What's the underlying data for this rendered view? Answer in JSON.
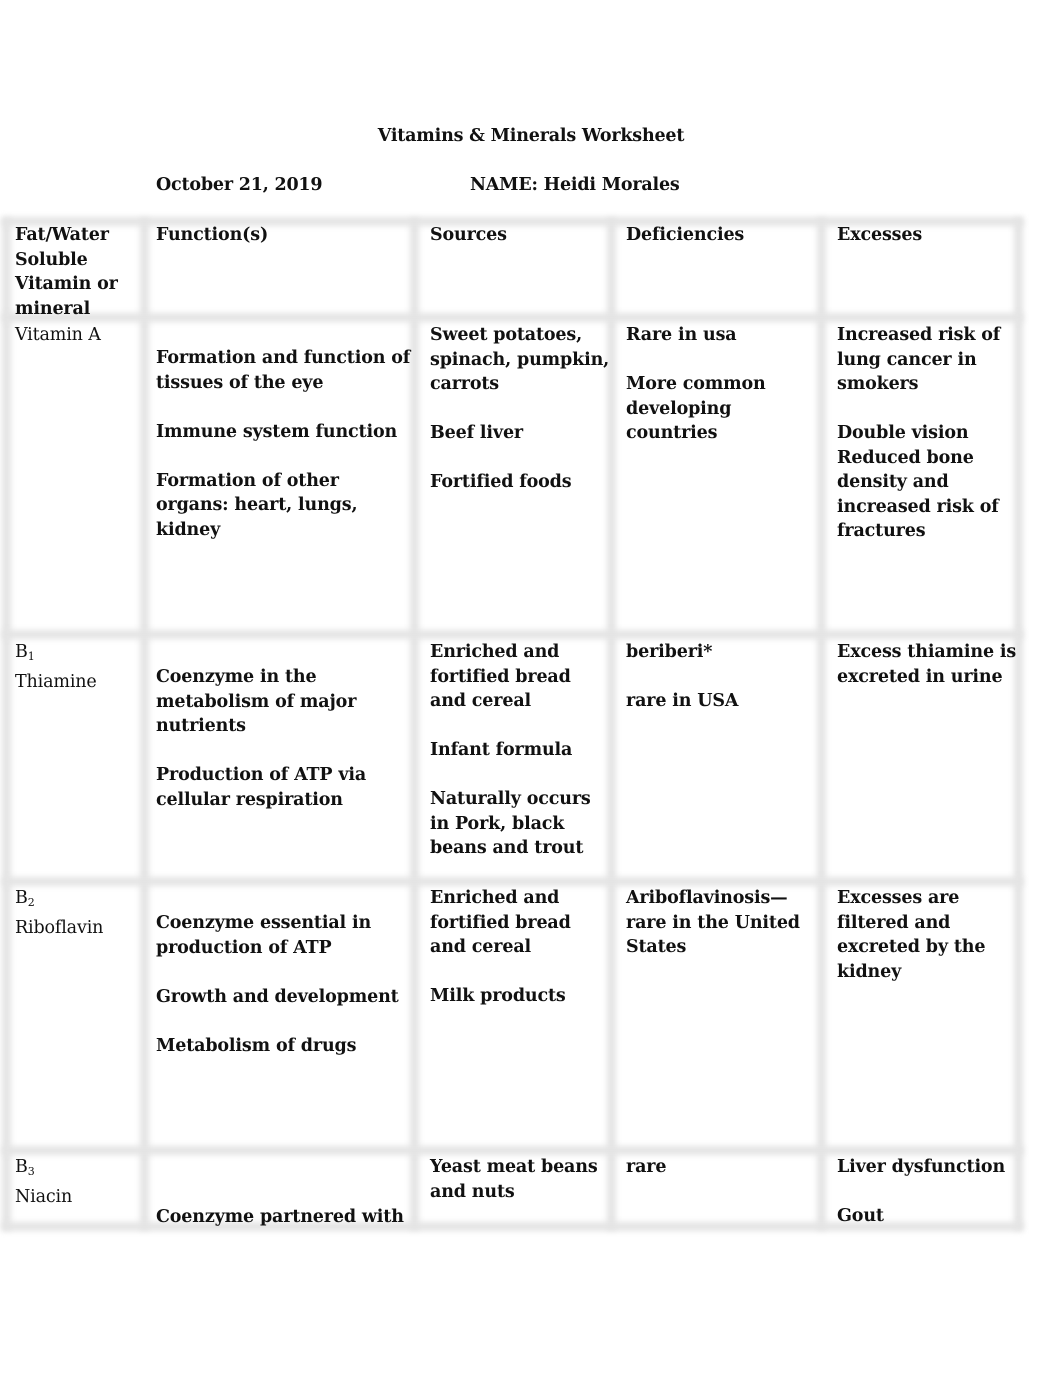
{
  "document": {
    "title": "Vitamins & Minerals Worksheet",
    "date": "October 21, 2019",
    "name_line": "NAME: Heidi Morales"
  },
  "table": {
    "headers": [
      "Fat/Water\nSoluble\nVitamin or\nmineral",
      "Function(s)",
      "Sources",
      "Deficiencies",
      "Excesses"
    ],
    "rows": [
      {
        "vitamin_prefix": "",
        "vitamin_subscript": "",
        "vitamin_name": "Vitamin A",
        "functions": "Formation and function of\ntissues of the eye\n\nImmune system function\n\nFormation of other\norgans: heart, lungs,\nkidney",
        "sources": "Sweet potatoes,\nspinach, pumpkin,\ncarrots\n\nBeef liver\n\nFortified foods",
        "deficiencies": "Rare in usa\n\nMore common\ndeveloping\ncountries",
        "excesses": " Increased risk of\nlung cancer in\nsmokers\n\nDouble vision\nReduced bone\ndensity and\nincreased risk of\nfractures"
      },
      {
        "vitamin_prefix": "B",
        "vitamin_subscript": "1",
        "vitamin_name": "Thiamine",
        "functions": "Coenzyme in the\nmetabolism of major\nnutrients\n\nProduction of ATP via\ncellular respiration",
        "sources": "Enriched and\nfortified bread\nand cereal\n\nInfant formula\n\nNaturally occurs\nin Pork, black\nbeans and trout",
        "deficiencies": "beriberi*\n\nrare in USA",
        "excesses": "Excess thiamine is\nexcreted in urine"
      },
      {
        "vitamin_prefix": "B",
        "vitamin_subscript": "2",
        "vitamin_name": "Riboflavin",
        "functions": "Coenzyme essential in\nproduction of ATP\n\nGrowth and development\n\nMetabolism of drugs",
        "sources": "Enriched and\nfortified bread\nand cereal\n\nMilk products",
        "deficiencies": "Ariboflavinosis—\nrare in the United\nStates",
        "excesses": "Excesses are\nfiltered and\nexcreted by the\nkidney"
      },
      {
        "vitamin_prefix": "B",
        "vitamin_subscript": "3",
        "vitamin_name": "Niacin",
        "functions": "Coenzyme partnered with",
        "sources": "Yeast meat beans\nand nuts",
        "deficiencies": "rare",
        "excesses": "Liver dysfunction\n\nGout"
      }
    ]
  }
}
